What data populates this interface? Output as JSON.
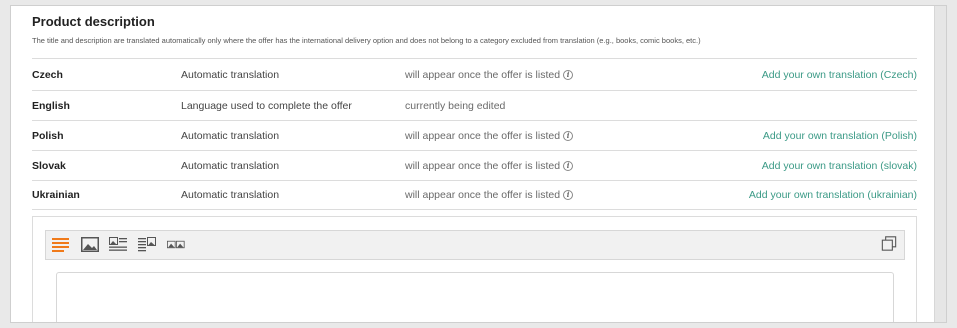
{
  "section": {
    "title": "Product description",
    "subtitle": "The title and description are translated automatically only where the offer has the international delivery option and does not belong to a category excluded from translation (e.g., books, comic books, etc.)"
  },
  "rows": [
    {
      "language": "Czech",
      "mode": "Automatic translation",
      "status": "will appear once the offer is listed",
      "link": "Add your own translation (Czech)"
    },
    {
      "language": "English",
      "mode": "Language used to complete the offer",
      "status": "currently being edited",
      "link": ""
    },
    {
      "language": "Polish",
      "mode": "Automatic translation",
      "status": "will appear once the offer is listed",
      "link": "Add your own translation (Polish)"
    },
    {
      "language": "Slovak",
      "mode": "Automatic translation",
      "status": "will appear once the offer is listed",
      "link": "Add your own translation (slovak)"
    },
    {
      "language": "Ukrainian",
      "mode": "Automatic translation",
      "status": "will appear once the offer is listed",
      "link": "Add your own translation (ukrainian)"
    }
  ],
  "info_glyph": "i",
  "toolbar": {
    "icons": [
      "text-block-icon",
      "image-block-icon",
      "image-text-block-icon",
      "text-image-block-icon",
      "two-images-block-icon",
      "copy-icon"
    ]
  },
  "colors": {
    "link": "#3b9a86",
    "accent": "#f07a1a"
  }
}
